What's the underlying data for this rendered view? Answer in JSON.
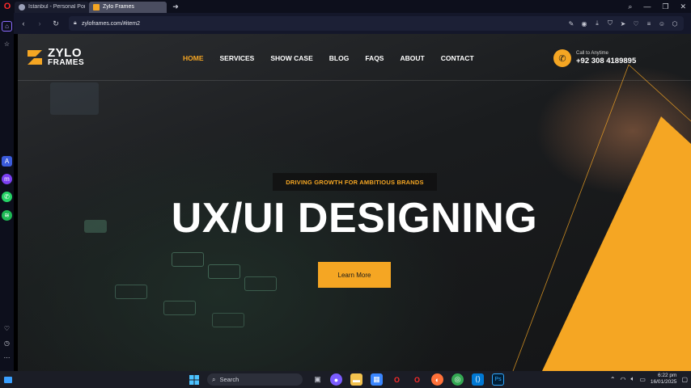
{
  "browser": {
    "tabs": [
      {
        "label": "Istanbul - Personal Portfol",
        "active": false
      },
      {
        "label": "Zylo Frames",
        "active": true
      }
    ],
    "url": "zyloframes.com/#item2"
  },
  "site": {
    "logo": {
      "line1": "ZYLO",
      "line2": "FRAMES"
    },
    "nav": [
      "HOME",
      "SERVICES",
      "SHOW CASE",
      "BLOG",
      "FAQS",
      "ABOUT",
      "CONTACT"
    ],
    "active_nav": "HOME",
    "call": {
      "label": "Call to Anytime",
      "number": "+92 308 4189895"
    },
    "tagline": "DRIVING GROWTH FOR AMBITIOUS BRANDS",
    "headline": "UX/UI DESIGNING",
    "cta": "Learn More",
    "colors": {
      "accent": "#f5a623",
      "background": "#1c1d1f"
    }
  },
  "taskbar": {
    "search_label": "Search",
    "time": "6:22 pm",
    "date": "16/01/2025"
  }
}
